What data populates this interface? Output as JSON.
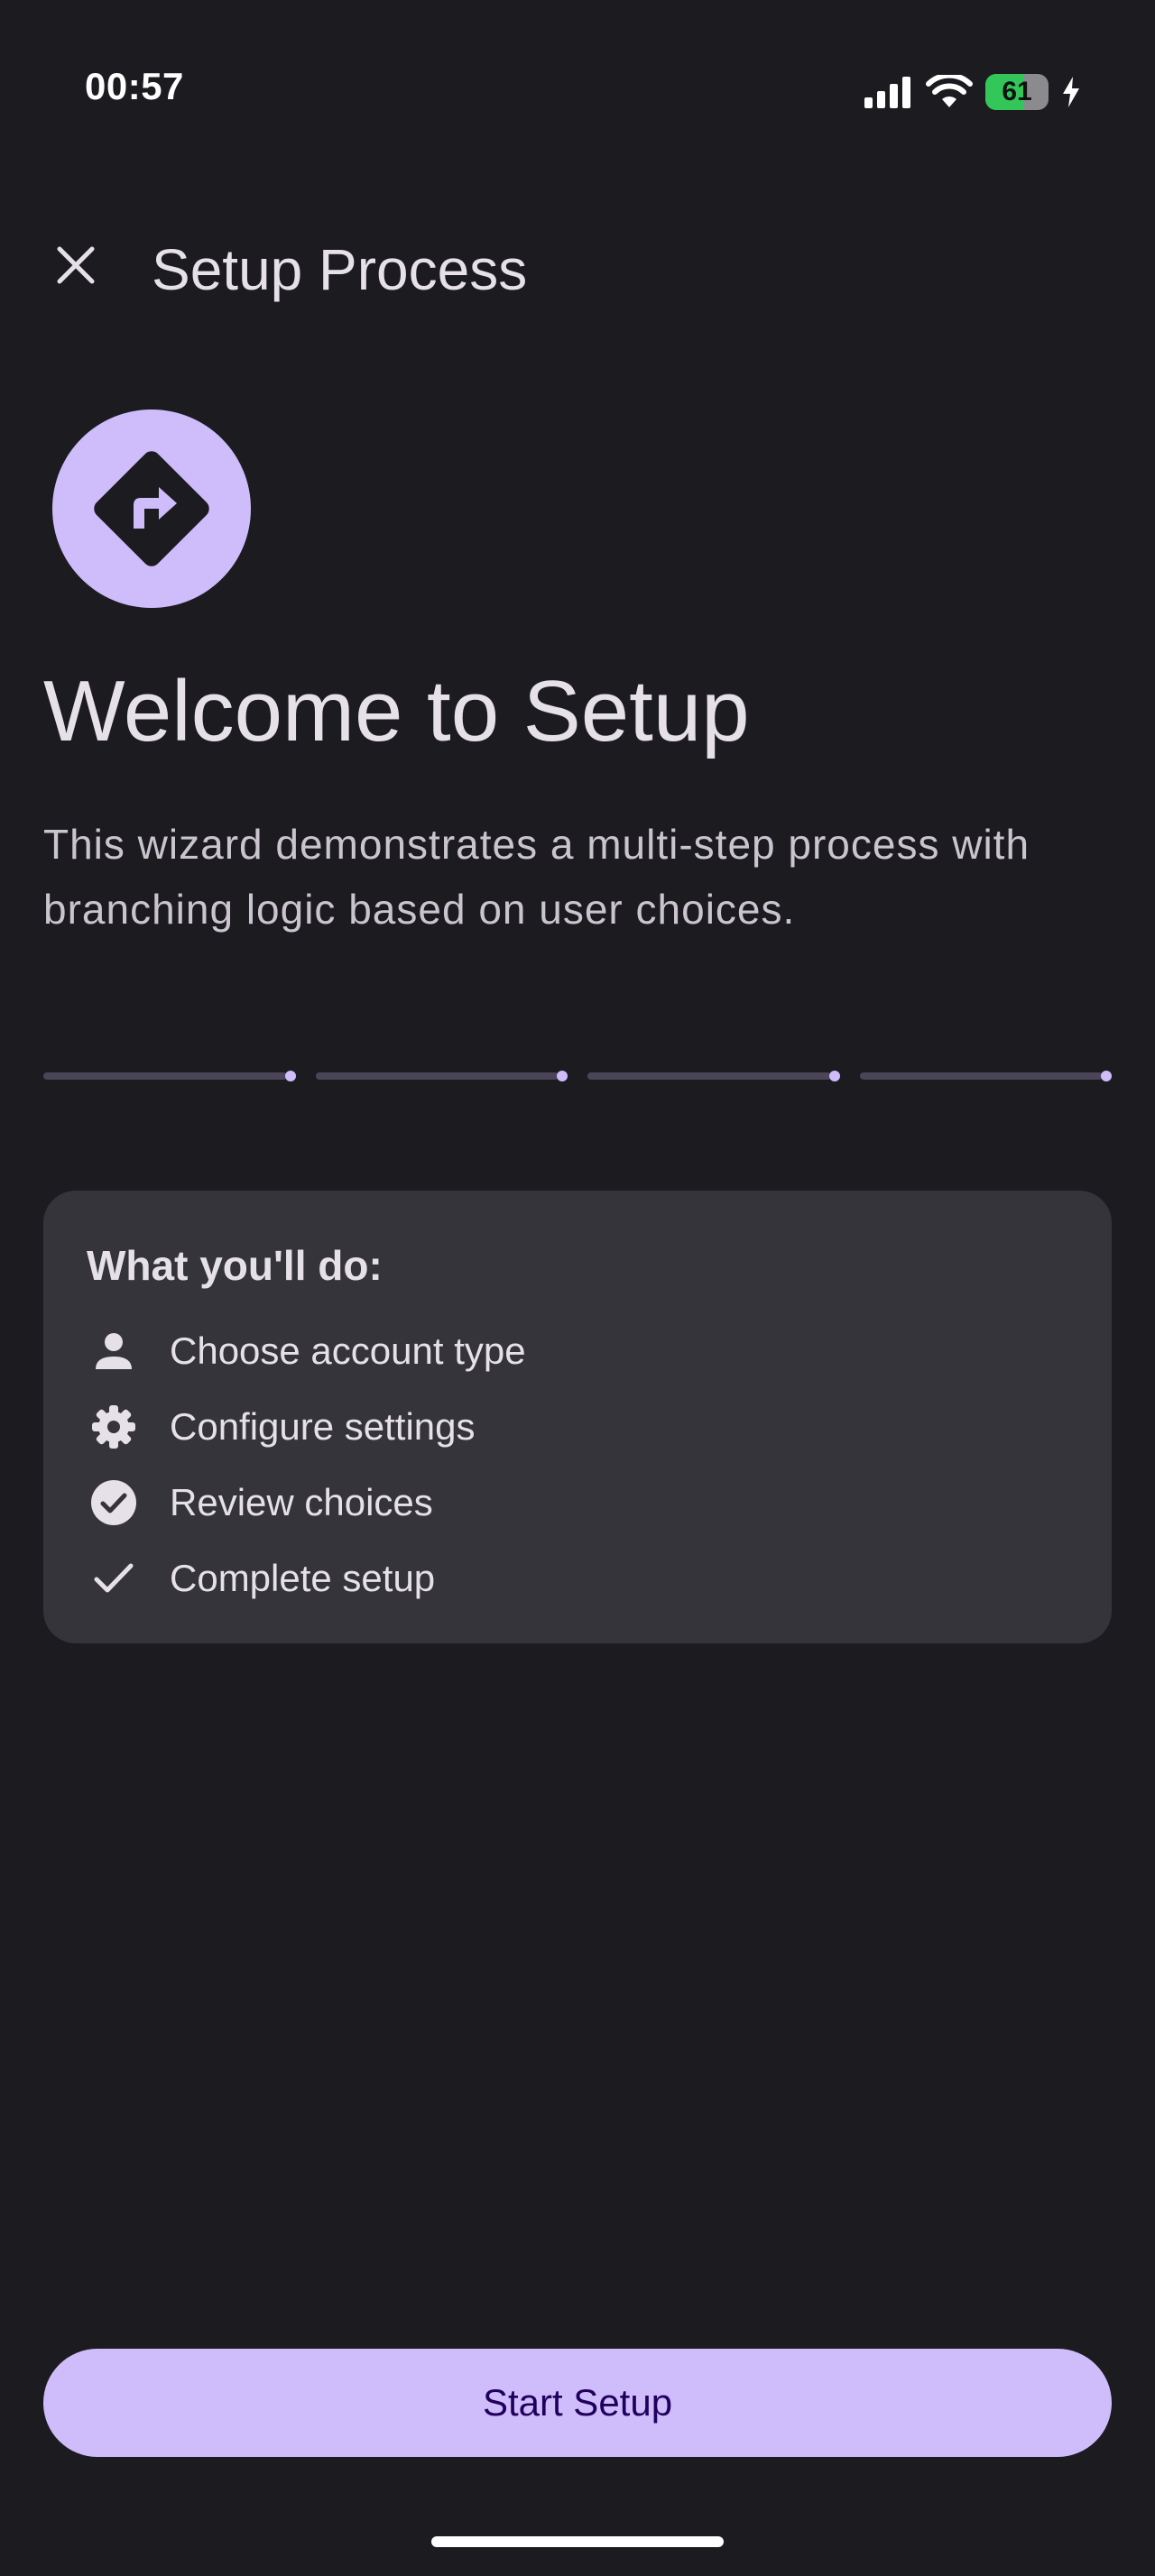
{
  "status_bar": {
    "time": "00:57",
    "battery": "61",
    "icons": [
      "signal-icon",
      "wifi-icon",
      "battery-icon",
      "charging-icon"
    ]
  },
  "app_bar": {
    "close_icon": "close-icon",
    "title": "Setup Process"
  },
  "hero": {
    "icon": "turn-right-sign-icon",
    "title": "Welcome to Setup",
    "description": "This wizard demonstrates a multi-step process with branching logic based on user choices."
  },
  "progress": {
    "steps_total": 4,
    "current_step": 0
  },
  "card": {
    "title": "What you'll do:",
    "items": [
      {
        "icon": "person-icon",
        "label": "Choose account type"
      },
      {
        "icon": "gear-icon",
        "label": "Configure settings"
      },
      {
        "icon": "check-circle-icon",
        "label": "Review choices"
      },
      {
        "icon": "check-icon",
        "label": "Complete setup"
      }
    ]
  },
  "actions": {
    "start_label": "Start Setup"
  },
  "colors": {
    "background": "#1c1b20",
    "accent": "#cfbdfb",
    "card": "#36343b",
    "on_accent": "#21005d",
    "battery_green": "#33c759"
  }
}
